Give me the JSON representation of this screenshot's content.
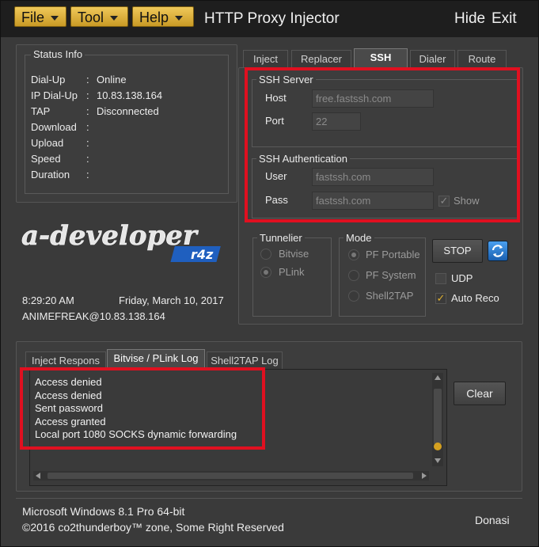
{
  "menu": {
    "file": "File",
    "tool": "Tool",
    "help": "Help"
  },
  "window": {
    "title": "HTTP Proxy Injector",
    "hide": "Hide",
    "exit": "Exit"
  },
  "status": {
    "title": "Status Info",
    "rows": [
      {
        "label": "Dial-Up",
        "value": "Online"
      },
      {
        "label": "IP Dial-Up",
        "value": "10.83.138.164"
      },
      {
        "label": "TAP",
        "value": "Disconnected"
      },
      {
        "label": "Download",
        "value": ""
      },
      {
        "label": "Upload",
        "value": ""
      },
      {
        "label": "Speed",
        "value": ""
      },
      {
        "label": "Duration",
        "value": ""
      }
    ]
  },
  "logo": {
    "text": "a-developer",
    "badge": "r4z"
  },
  "clock": {
    "time": "8:29:20 AM",
    "date": "Friday, March 10, 2017",
    "user": "ANIMEFREAK@10.83.138.164"
  },
  "tabs": [
    "Inject",
    "Replacer",
    "SSH",
    "Dialer",
    "Route"
  ],
  "ssh": {
    "server_title": "SSH Server",
    "host_label": "Host",
    "host_value": "free.fastssh.com",
    "port_label": "Port",
    "port_value": "22",
    "auth_title": "SSH Authentication",
    "user_label": "User",
    "user_value": "fastssh.com",
    "pass_label": "Pass",
    "pass_value": "fastssh.com",
    "show_label": "Show"
  },
  "tunnelier": {
    "title": "Tunnelier",
    "options": [
      "Bitvise",
      "PLink"
    ]
  },
  "mode": {
    "title": "Mode",
    "options": [
      "PF Portable",
      "PF System",
      "Shell2TAP"
    ]
  },
  "controls": {
    "stop": "STOP",
    "udp": "UDP",
    "autoreco": "Auto Reco",
    "autoreco_check": "✓"
  },
  "logtabs": [
    "Inject Respons",
    "Bitvise / PLink Log",
    "Shell2TAP Log"
  ],
  "log": {
    "lines": [
      "Access denied",
      "Access denied",
      "Sent password",
      "Access granted",
      "Local port 1080 SOCKS dynamic forwarding"
    ],
    "clear": "Clear"
  },
  "footer": {
    "os": "Microsoft Windows 8.1 Pro 64-bit",
    "copyright": "©2016 co2thunderboy™ zone, Some Right Reserved",
    "donasi": "Donasi"
  }
}
